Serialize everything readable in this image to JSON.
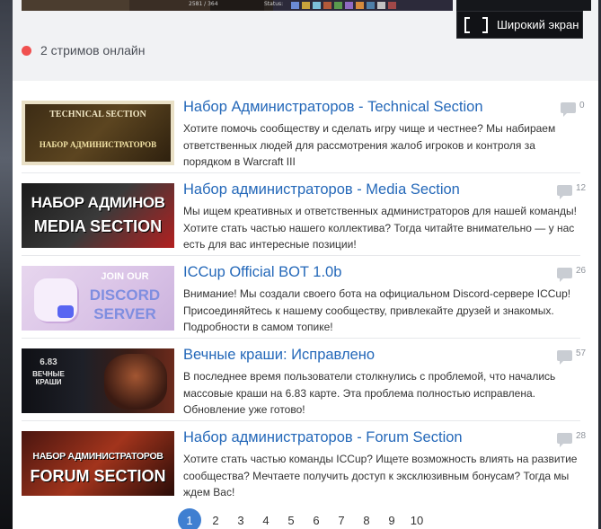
{
  "stream": {
    "status_label": "Status:",
    "counter": "2581 / 364",
    "wide_screen_label": "Широкий экран",
    "online_text": "2 стримов онлайн"
  },
  "news": [
    {
      "thumb_line1": "TECHNICAL SECTION",
      "thumb_line2": "НАБОР АДМИНИСТРАТОРОВ",
      "title": "Набор Администраторов - Technical Section",
      "description": "Хотите помочь сообществу и сделать игру чище и честнее? Мы набираем ответственных людей для рассмотрения жалоб игроков и контроля за порядком в Warcraft III",
      "comments": "0"
    },
    {
      "thumb_line1": "НАБОР АДМИНОВ",
      "thumb_line2": "MEDIA SECTION",
      "title": "Набор администраторов - Media Section",
      "description": "Мы ищем креативных и ответственных администраторов для нашей команды! Хотите стать частью нашего коллектива? Тогда читайте внимательно — у нас есть для вас интересные позиции!",
      "comments": "12"
    },
    {
      "thumb_line1": "JOIN OUR",
      "thumb_line2": "DISCORD SERVER",
      "title": "ICCup Official BOT 1.0b",
      "description": "Внимание! Мы создали своего бота на официальном Discord-сервере ICCup! Присоединяйтесь к нашему сообществу, привлекайте друзей и знакомых. Подробности в самом топике!",
      "comments": "26"
    },
    {
      "thumb_line1": "6.83",
      "thumb_line2": "ВЕЧНЫЕ КРАШИ",
      "title": "Вечные краши: Исправлено",
      "description": "В последнее время пользователи столкнулись с проблемой, что начались массовые краши на 6.83 карте. Эта проблема полностью исправлена. Обновление уже готово!",
      "comments": "57"
    },
    {
      "thumb_line1": "НАБОР АДМИНИСТРАТОРОВ",
      "thumb_line2": "FORUM SECTION",
      "title": "Набор администраторов - Forum Section",
      "description": "Хотите стать частью команды ICCup? Ищете возможность влиять на развитие сообщества? Мечтаете получить доступ к эксклюзивным бонусам? Тогда мы ждем Вас!",
      "comments": "28"
    }
  ],
  "pagination": {
    "pages": [
      "1",
      "2",
      "3",
      "4",
      "5",
      "6",
      "7",
      "8",
      "9",
      "10"
    ],
    "active": "1"
  },
  "colors": {
    "accent": "#3f7fd1",
    "title_link": "#2468b9",
    "online_dot": "#f0504f"
  }
}
